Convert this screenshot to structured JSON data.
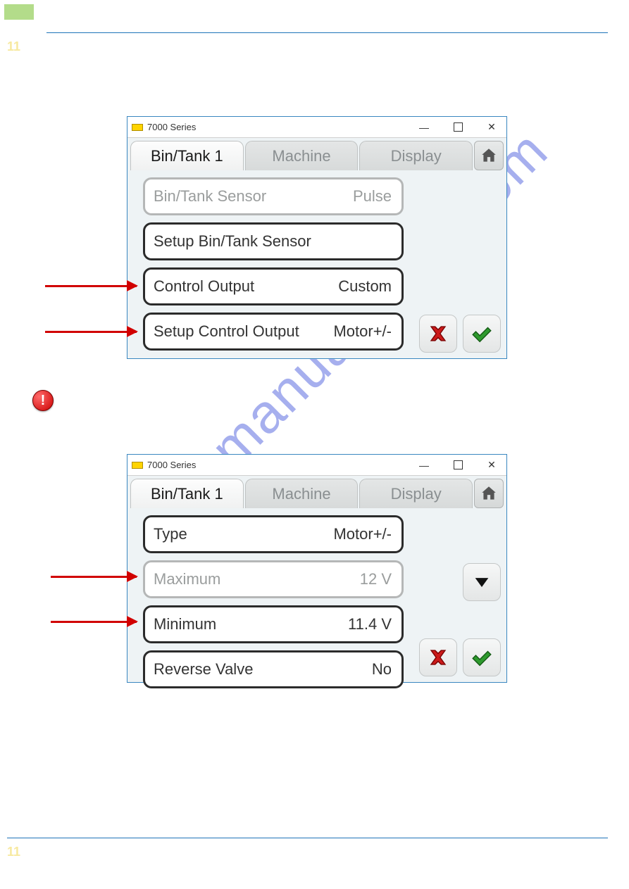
{
  "page": {
    "top_num": "11",
    "bot_num": "11"
  },
  "watermark": "manualshive.com",
  "window1": {
    "title": "7000 Series",
    "tabs": {
      "active": "Bin/Tank 1",
      "t2": "Machine",
      "t3": "Display"
    },
    "rows": [
      {
        "label": "Bin/Tank Sensor",
        "value": "Pulse",
        "kind": "disabled"
      },
      {
        "label": "Setup Bin/Tank Sensor",
        "value": "",
        "kind": "normal"
      },
      {
        "label": "Control Output",
        "value": "Custom",
        "kind": "normal"
      },
      {
        "label": "Setup Control Output",
        "value": "Motor+/-",
        "kind": "normal"
      }
    ]
  },
  "window2": {
    "title": "7000 Series",
    "tabs": {
      "active": "Bin/Tank 1",
      "t2": "Machine",
      "t3": "Display"
    },
    "rows": [
      {
        "label": "Type",
        "value": "Motor+/-",
        "kind": "normal"
      },
      {
        "label": "Maximum",
        "value": "12 V",
        "kind": "disabled"
      },
      {
        "label": "Minimum",
        "value": "11.4 V",
        "kind": "normal"
      },
      {
        "label": "Reverse Valve",
        "value": "No",
        "kind": "normal"
      }
    ]
  },
  "icons": {
    "home": "home-icon",
    "cancel": "x-icon",
    "confirm": "check-icon",
    "scroll_down": "down-triangle-icon",
    "alert": "alert-icon"
  }
}
